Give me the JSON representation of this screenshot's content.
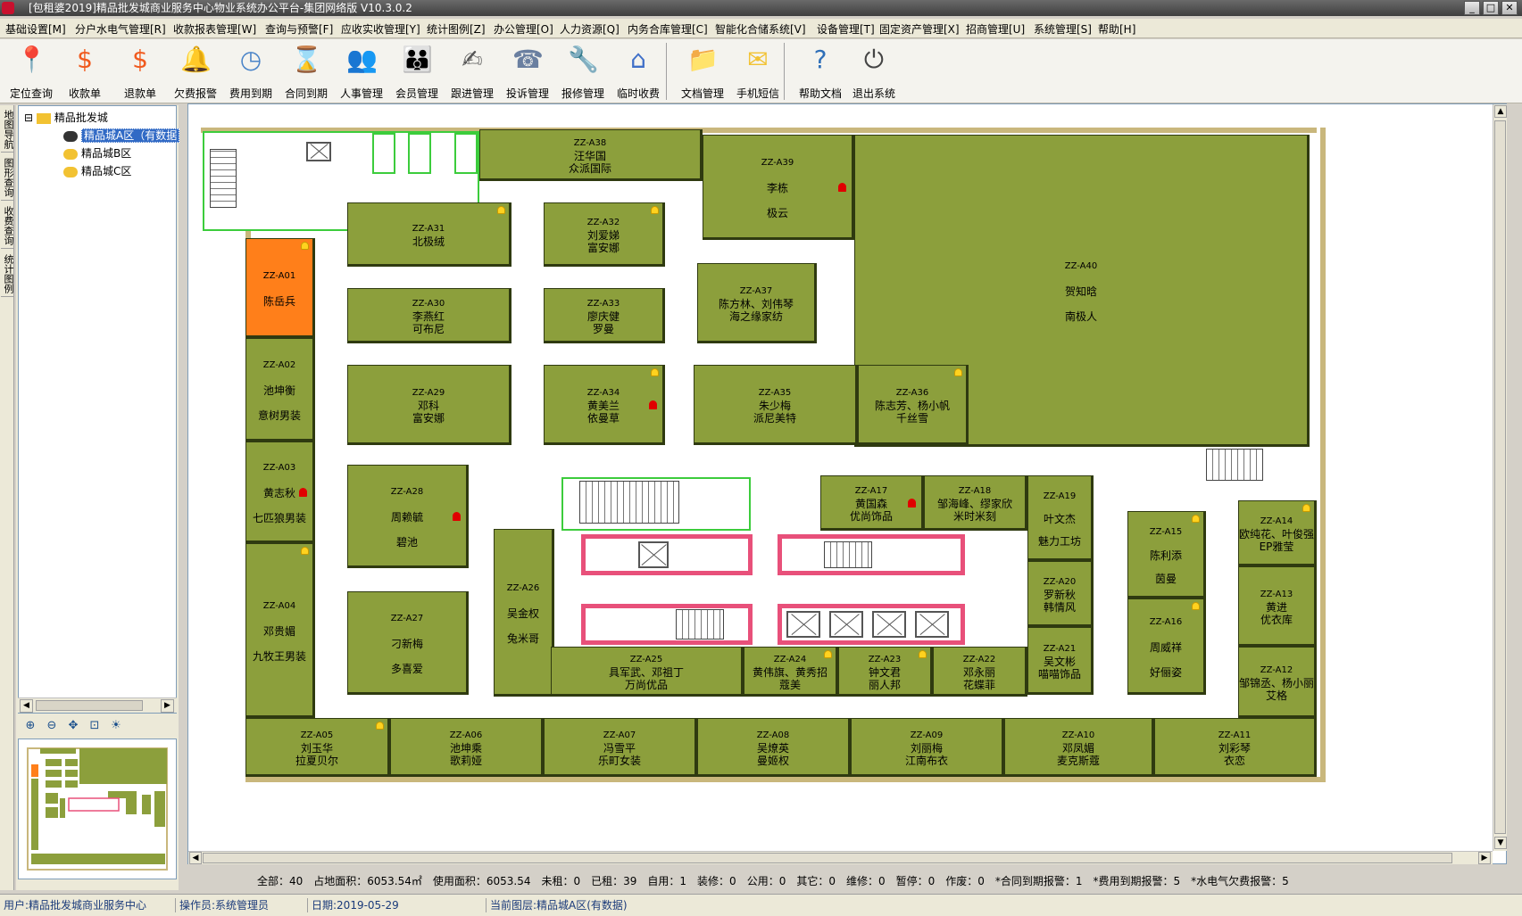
{
  "window": {
    "title": "[包租婆2019]精品批发城商业服务中心物业系统办公平台-集团网络版 V10.3.0.2"
  },
  "menu": [
    "基础设置[M]",
    "分户水电气管理[R]",
    "收款报表管理[W]",
    "查询与预警[F]",
    "应收实收管理[Y]",
    "统计图例[Z]",
    "办公管理[O]",
    "人力资源[Q]",
    "内务合库管理[C]",
    "智能化合储系统[V]",
    "设备管理[T]",
    "固定资产管理[X]",
    "招商管理[U]",
    "系统管理[S]",
    "帮助[H]"
  ],
  "toolbar": [
    {
      "label": "定位查询",
      "icon": "location-pin-icon",
      "color": "#2db24a"
    },
    {
      "label": "收款单",
      "icon": "dollar-refresh-icon",
      "color": "#f05a1e"
    },
    {
      "label": "退款单",
      "icon": "dollar-refund-icon",
      "color": "#f05a1e"
    },
    {
      "label": "欠费报警",
      "icon": "bell-icon",
      "color": "#f2b21b"
    },
    {
      "label": "费用到期",
      "icon": "clock-icon",
      "color": "#4a84c8"
    },
    {
      "label": "合同到期",
      "icon": "hourglass-icon",
      "color": "#6c9ad0"
    },
    {
      "label": "人事管理",
      "icon": "people-icon",
      "color": "#c8602a"
    },
    {
      "label": "会员管理",
      "icon": "members-icon",
      "color": "#4f8f3f"
    },
    {
      "label": "跟进管理",
      "icon": "follow-up-icon",
      "color": "#555555"
    },
    {
      "label": "投诉管理",
      "icon": "complaint-icon",
      "color": "#6a7fa0"
    },
    {
      "label": "报修管理",
      "icon": "repair-icon",
      "color": "#3f7fb0"
    },
    {
      "label": "临时收费",
      "icon": "house-icon",
      "color": "#3f6fc8"
    },
    {
      "label": "文档管理",
      "icon": "folder-icon",
      "color": "#f2c232"
    },
    {
      "label": "手机短信",
      "icon": "sms-icon",
      "color": "#f2c232"
    },
    {
      "label": "帮助文档",
      "icon": "help-book-icon",
      "color": "#2f6fb8"
    },
    {
      "label": "退出系统",
      "icon": "power-icon",
      "color": "#444444"
    }
  ],
  "side_tabs": [
    "地图导航",
    "图形查询",
    "收费查询",
    "统计图例"
  ],
  "tree": {
    "root": "精品批发城",
    "children": [
      "精品城A区（有数据",
      "精品城B区",
      "精品城C区"
    ],
    "selected_index": 0
  },
  "units": [
    {
      "code": "ZZ-A38",
      "lines": [
        "汪华国",
        "众派国际"
      ]
    },
    {
      "code": "ZZ-A39",
      "lines": [
        "李栋",
        "极云"
      ]
    },
    {
      "code": "ZZ-A40",
      "lines": [
        "贺知晗",
        "南极人"
      ]
    },
    {
      "code": "ZZ-A31",
      "lines": [
        "北极绒"
      ]
    },
    {
      "code": "ZZ-A32",
      "lines": [
        "刘爱娣",
        "富安娜"
      ]
    },
    {
      "code": "ZZ-A01",
      "lines": [
        "陈岳兵"
      ]
    },
    {
      "code": "ZZ-A30",
      "lines": [
        "李燕红",
        "可布尼"
      ]
    },
    {
      "code": "ZZ-A33",
      "lines": [
        "廖庆健",
        "罗曼"
      ]
    },
    {
      "code": "ZZ-A37",
      "lines": [
        "陈方林、刘伟琴",
        "海之缘家纺"
      ]
    },
    {
      "code": "ZZ-A02",
      "lines": [
        "池坤衡",
        "意树男装"
      ]
    },
    {
      "code": "ZZ-A29",
      "lines": [
        "邓科",
        "富安娜"
      ]
    },
    {
      "code": "ZZ-A34",
      "lines": [
        "黄美兰",
        "依曼草"
      ]
    },
    {
      "code": "ZZ-A35",
      "lines": [
        "朱少梅",
        "派尼美特"
      ]
    },
    {
      "code": "ZZ-A36",
      "lines": [
        "陈志芳、杨小帆",
        "千丝雪"
      ]
    },
    {
      "code": "ZZ-A03",
      "lines": [
        "黄志秋",
        "七匹狼男装"
      ]
    },
    {
      "code": "ZZ-A28",
      "lines": [
        "周赖毓",
        "碧池"
      ]
    },
    {
      "code": "ZZ-A17",
      "lines": [
        "黄国森",
        "优尚饰品"
      ]
    },
    {
      "code": "ZZ-A18",
      "lines": [
        "邹海峰、缪家欣",
        "米时米刻"
      ]
    },
    {
      "code": "ZZ-A19",
      "lines": [
        "叶文杰",
        "魅力工坊"
      ]
    },
    {
      "code": "ZZ-A14",
      "lines": [
        "欧纯花、叶俊强",
        "EP雅莹"
      ]
    },
    {
      "code": "ZZ-A15",
      "lines": [
        "陈利添",
        "茵曼"
      ]
    },
    {
      "code": "ZZ-A26",
      "lines": [
        "吴金权",
        "兔米哥"
      ]
    },
    {
      "code": "ZZ-A04",
      "lines": [
        "邓贵媚",
        "九牧王男装"
      ]
    },
    {
      "code": "ZZ-A20",
      "lines": [
        "罗新秋",
        "韩情风"
      ]
    },
    {
      "code": "ZZ-A13",
      "lines": [
        "黄进",
        "优衣库"
      ]
    },
    {
      "code": "ZZ-A27",
      "lines": [
        "刁新梅",
        "多喜爱"
      ]
    },
    {
      "code": "ZZ-A16",
      "lines": [
        "周威祥",
        "好俪姿"
      ]
    },
    {
      "code": "ZZ-A21",
      "lines": [
        "吴文彬",
        "喵喵饰品"
      ]
    },
    {
      "code": "ZZ-A25",
      "lines": [
        "具军武、邓祖丁",
        "万尚优品"
      ]
    },
    {
      "code": "ZZ-A24",
      "lines": [
        "黄伟旗、黄秀招",
        "蔻美"
      ]
    },
    {
      "code": "ZZ-A23",
      "lines": [
        "钟文君",
        "丽人邦"
      ]
    },
    {
      "code": "ZZ-A22",
      "lines": [
        "邓永丽",
        "花蝶菲"
      ]
    },
    {
      "code": "ZZ-A12",
      "lines": [
        "邹锦丞、杨小丽",
        "艾格"
      ]
    },
    {
      "code": "ZZ-A05",
      "lines": [
        "刘玉华",
        "拉夏贝尔"
      ]
    },
    {
      "code": "ZZ-A06",
      "lines": [
        "池坤乘",
        "歌莉娅"
      ]
    },
    {
      "code": "ZZ-A07",
      "lines": [
        "冯雪平",
        "乐町女装"
      ]
    },
    {
      "code": "ZZ-A08",
      "lines": [
        "吴燎英",
        "曼姬权"
      ]
    },
    {
      "code": "ZZ-A09",
      "lines": [
        "刘丽梅",
        "江南布衣"
      ]
    },
    {
      "code": "ZZ-A10",
      "lines": [
        "邓凤媚",
        "麦克斯蔻"
      ]
    },
    {
      "code": "ZZ-A11",
      "lines": [
        "刘彩琴",
        "衣恋"
      ]
    }
  ],
  "summary": "全部：40　占地面积：6053.54㎡　使用面积：6053.54　未租：0　已租：39　自用：1　装修：0　公用：0　其它：0　维修：0　暂停：0　作废：0　*合同到期报警：1　*费用到期报警：5　*水电气欠费报警：5",
  "status": {
    "user": "用户:精品批发城商业服务中心",
    "operator": "操作员:系统管理员",
    "date": "日期:2019-05-29",
    "layer": "当前图层:精品城A区(有数据)"
  },
  "colors": {
    "unit_green": "#8c9f3c",
    "unit_orange": "#ff7f1a",
    "wall": "#c9b77c",
    "corridor": "#ffffff",
    "selection": "#316ac5"
  },
  "mini_tools": [
    "zoom-in-icon",
    "zoom-out-icon",
    "pan-icon",
    "fit-icon",
    "light-icon"
  ]
}
